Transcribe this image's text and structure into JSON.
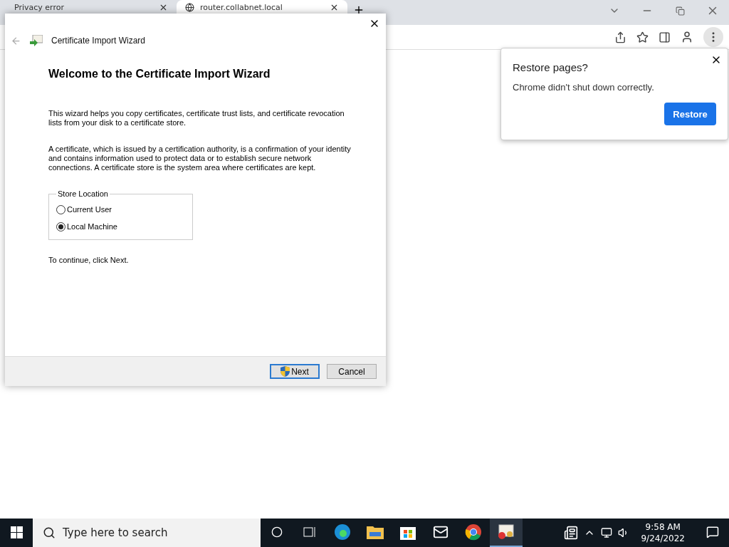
{
  "browser": {
    "tabs": [
      {
        "title": "Privacy error",
        "selected": false
      },
      {
        "title": "router.collabnet.local",
        "selected": true
      }
    ]
  },
  "wizard": {
    "title": "Certificate Import Wizard",
    "heading": "Welcome to the Certificate Import Wizard",
    "paragraphs": [
      "This wizard helps you copy certificates, certificate trust lists, and certificate revocation lists from your disk to a certificate store.",
      "A certificate, which is issued by a certification authority, is a confirmation of your identity and contains information used to protect data or to establish secure network connections. A certificate store is the system area where certificates are kept."
    ],
    "store_location": {
      "label": "Store Location",
      "options": [
        {
          "label": "Current User",
          "selected": false
        },
        {
          "label": "Local Machine",
          "selected": true
        }
      ]
    },
    "hint": "To continue, click Next.",
    "buttons": [
      {
        "label": "Next",
        "kind": "primary"
      },
      {
        "label": "Cancel",
        "kind": "secondary"
      }
    ]
  },
  "restore_popup": {
    "title": "Restore pages?",
    "message": "Chrome didn't shut down correctly.",
    "button": "Restore"
  },
  "taskbar": {
    "search_placeholder": "Type here to search",
    "apps": [
      {
        "kind": "edge",
        "selected": false
      },
      {
        "kind": "explorer",
        "selected": false
      },
      {
        "kind": "store",
        "selected": false
      },
      {
        "kind": "mail",
        "selected": false
      },
      {
        "kind": "chrome",
        "selected": false
      },
      {
        "kind": "certificate",
        "selected": true
      }
    ],
    "time": "9:58 AM",
    "date": "9/24/2022"
  }
}
